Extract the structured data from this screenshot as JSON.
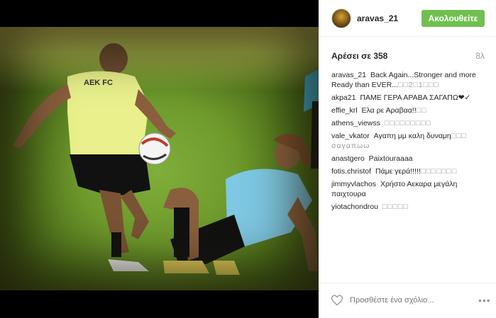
{
  "post": {
    "username": "aravas_21",
    "follow_label": "Ακολουθείτε",
    "likes_label": "Αρέσει σε 358",
    "timestamp": "8λ"
  },
  "comments": [
    {
      "author": "aravas_21",
      "text": "Back Again...Stronger and more Ready than EVER...",
      "suffix": "□□2□1□□□"
    },
    {
      "author": "akpa21",
      "text": "ΠΑΜΕ ΓΕΡΑ ΑΡΑΒΑ ΣΑΓΑΠΩ❤✓",
      "suffix": ""
    },
    {
      "author": "effie_krl",
      "text": "Ελα ρε Αραβαα!!",
      "suffix": "□□"
    },
    {
      "author": "athens_viewss",
      "text": "",
      "suffix": "□□□□□□□□□"
    },
    {
      "author": "vale_vkator",
      "text": "Αγαπη μμ καλη δυναμη",
      "suffix": "□□□ σαγαπωω"
    },
    {
      "author": "anastgero",
      "text": "Paixtouraaaa",
      "suffix": ""
    },
    {
      "author": "fotis.christof",
      "text": "Πάμε γερά!!!!!",
      "suffix": "□□□□□□□"
    },
    {
      "author": "jimmyvlachos",
      "text": "Χρήστο Αεκαρα μεγάλη παιχτουρα",
      "suffix": ""
    },
    {
      "author": "yiotachondrou",
      "text": "",
      "suffix": "□□□□□"
    }
  ],
  "add_comment": {
    "placeholder": "Προσθέστε ένα σχόλιο..."
  },
  "photo": {
    "shirt_text": "AEK FC"
  },
  "icons": {
    "like": "heart-icon",
    "more": "more-options-icon"
  },
  "colors": {
    "follow_button": "#70c050",
    "timestamp": "#999999"
  }
}
